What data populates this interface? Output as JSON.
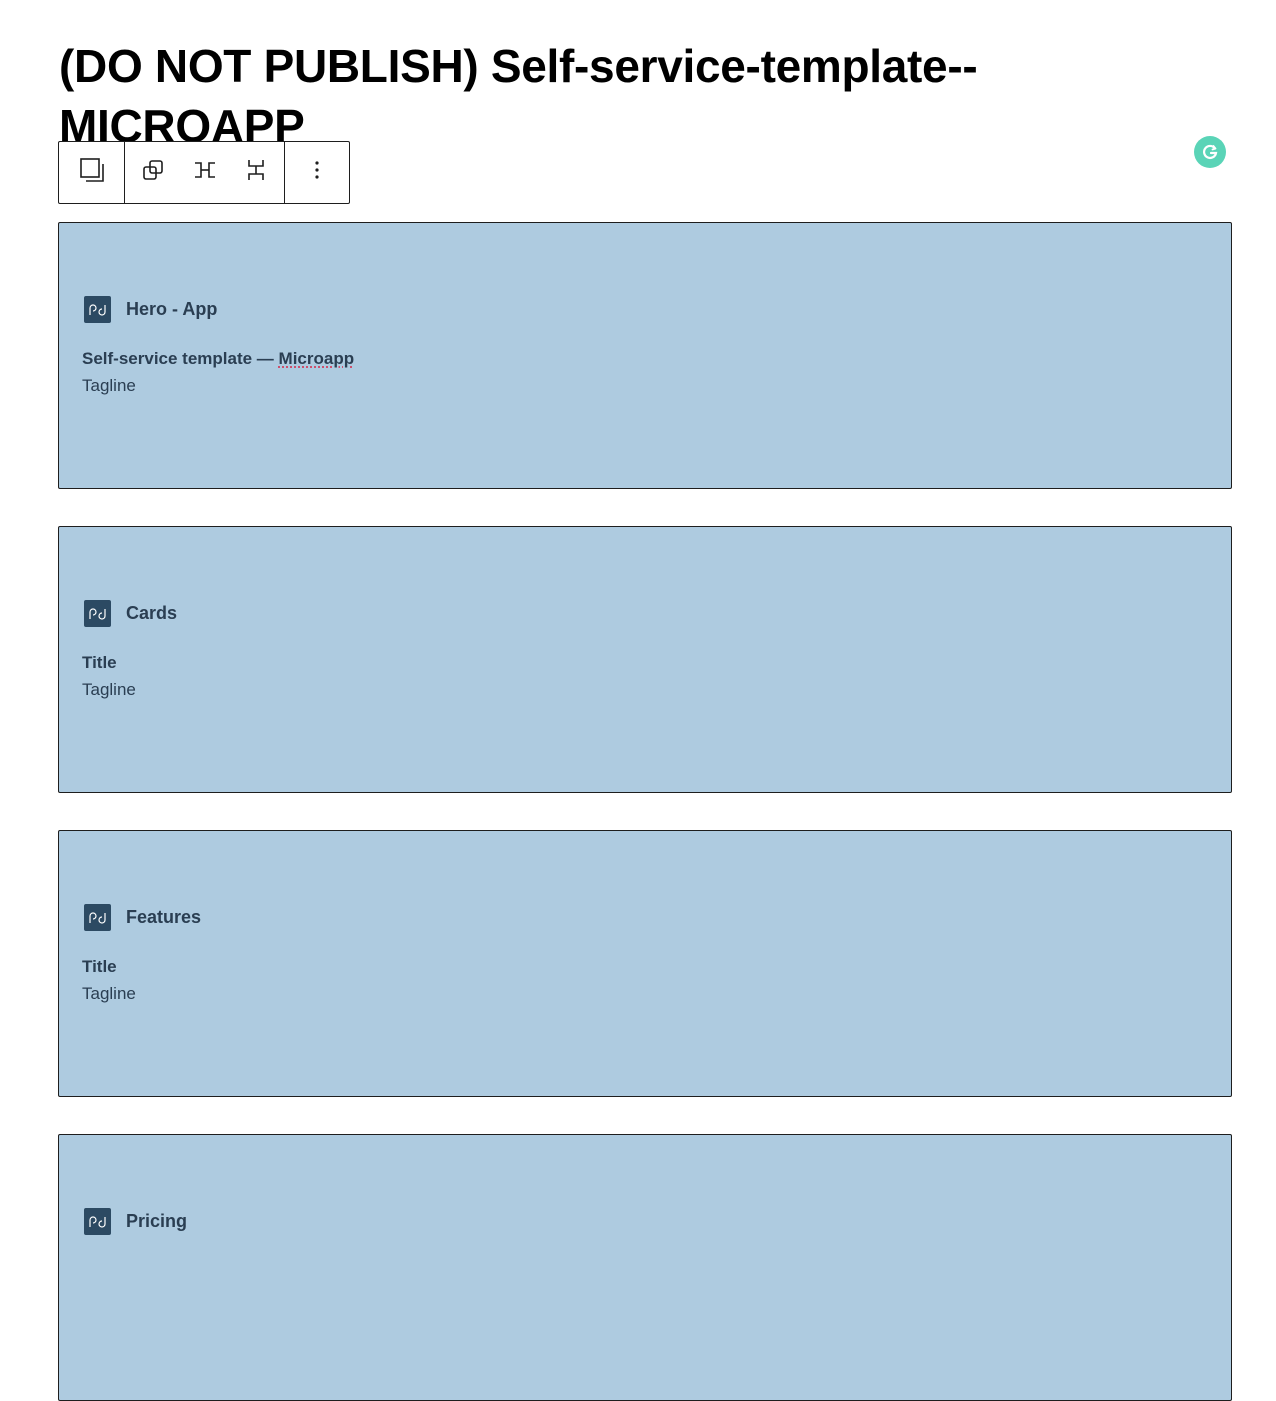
{
  "page": {
    "title": "(DO NOT PUBLISH) Self-service-template--MICROAPP"
  },
  "toolbar": {
    "buttons": [
      {
        "icon": "block-parent-icon",
        "label": "Select parent"
      },
      {
        "icon": "duplicate-icon",
        "label": "Duplicate"
      },
      {
        "icon": "justify-horizontal-icon",
        "label": "Horizontal"
      },
      {
        "icon": "justify-vertical-icon",
        "label": "Vertical"
      },
      {
        "icon": "more-options-icon",
        "label": "Options"
      }
    ]
  },
  "grammarly": {
    "icon": "grammarly-icon",
    "color": "#15c39a"
  },
  "blocks": [
    {
      "name": "Hero - App",
      "title_prefix": "Self-service template — ",
      "title_highlight": "Microapp",
      "tagline": "Tagline"
    },
    {
      "name": "Cards",
      "title_prefix": "Title",
      "title_highlight": "",
      "tagline": "Tagline"
    },
    {
      "name": "Features",
      "title_prefix": "Title",
      "title_highlight": "",
      "tagline": "Tagline"
    },
    {
      "name": "Pricing",
      "title_prefix": "",
      "title_highlight": "",
      "tagline": ""
    }
  ],
  "colors": {
    "block_background": "#aecbe0",
    "block_icon": "#2c4a63",
    "block_text": "#2a3e52",
    "spellcheck_underline": "#d13b5b"
  }
}
